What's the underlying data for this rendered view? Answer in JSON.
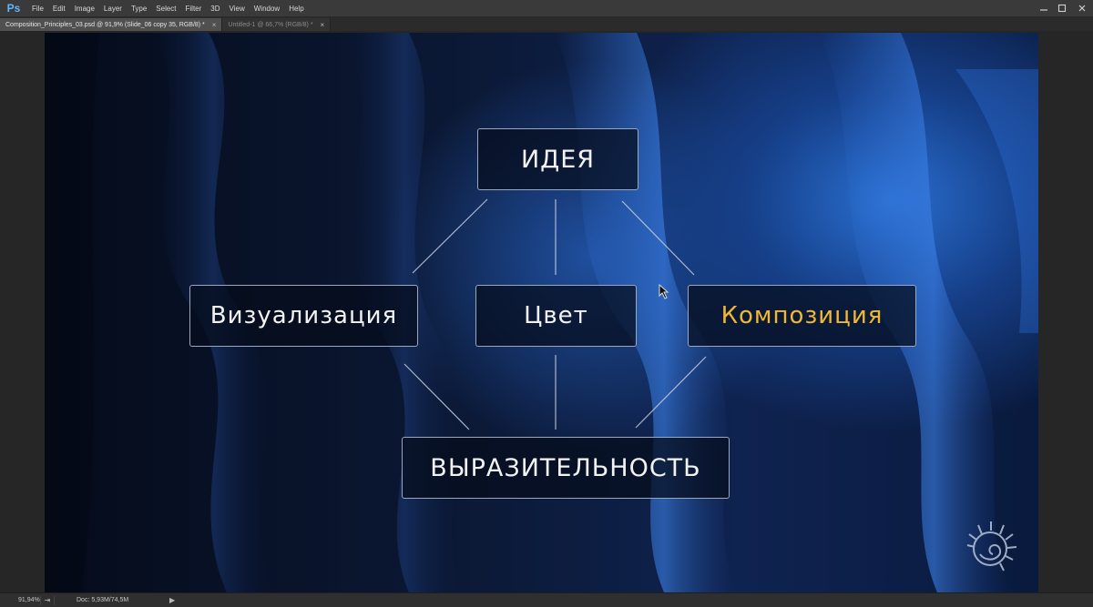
{
  "app": {
    "logo": "Ps"
  },
  "menu": [
    "File",
    "Edit",
    "Image",
    "Layer",
    "Type",
    "Select",
    "Filter",
    "3D",
    "View",
    "Window",
    "Help"
  ],
  "tabs": [
    {
      "label": "Composition_Principles_03.psd @ 91,9% (Slide_06 copy 35, RGB/8) *",
      "active": true
    },
    {
      "label": "Untitled-1 @ 66,7% (RGB/8) *",
      "active": false
    }
  ],
  "slide": {
    "boxes": {
      "idea": "ИДЕЯ",
      "visualization": "Визуализация",
      "color": "Цвет",
      "composition": "Композиция",
      "expressiveness": "ВЫРАЗИТЕЛЬНОСТЬ"
    },
    "highlight_color": "#f2b830"
  },
  "status": {
    "zoom": "91,94%",
    "doc": "Doc: 5,93M/74,5M"
  }
}
